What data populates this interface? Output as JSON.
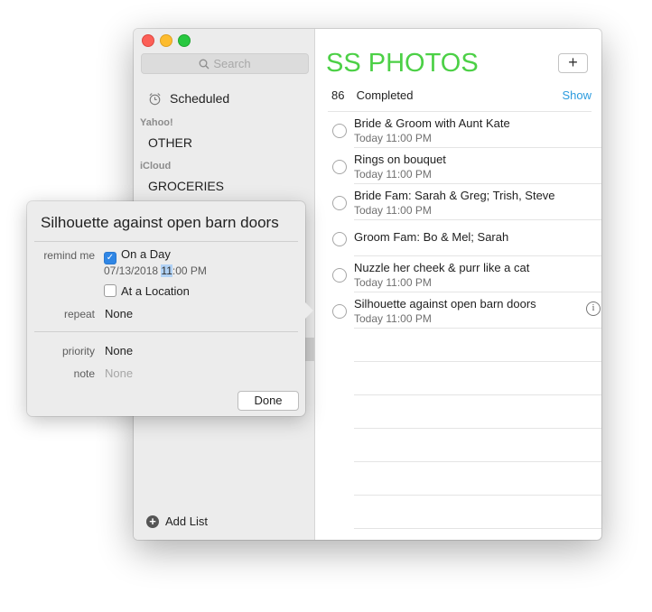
{
  "sidebar": {
    "search_placeholder": "Search",
    "scheduled_label": "Scheduled",
    "accounts": [
      {
        "name": "Yahoo!",
        "lists": [
          "OTHER"
        ]
      },
      {
        "name": "iCloud",
        "lists": [
          "GROCERIES"
        ]
      }
    ],
    "add_list_label": "Add List"
  },
  "main": {
    "list_title": "SS PHOTOS",
    "add_button_label": "+",
    "completed_count": "86",
    "completed_label": "Completed",
    "show_label": "Show",
    "tasks": [
      {
        "title": "Bride & Groom with Aunt Kate",
        "due": "Today 11:00 PM"
      },
      {
        "title": "Rings on bouquet",
        "due": "Today 11:00 PM"
      },
      {
        "title": "Bride Fam: Sarah & Greg; Trish, Steve",
        "due": "Today 11:00 PM"
      },
      {
        "title": "Groom Fam: Bo & Mel; Sarah",
        "due": ""
      },
      {
        "title": "Nuzzle her cheek & purr like a cat",
        "due": "Today 11:00 PM"
      },
      {
        "title": "Silhouette against open barn doors",
        "due": "Today 11:00 PM"
      }
    ]
  },
  "popover": {
    "title": "Silhouette against open barn doors",
    "remind_me_label": "remind me",
    "on_a_day_label": "On a Day",
    "date_prefix": "07/13/2018 ",
    "date_hour": "11",
    "date_suffix": ":00 PM",
    "at_location_label": "At a Location",
    "repeat_label": "repeat",
    "repeat_value": "None",
    "priority_label": "priority",
    "priority_value": "None",
    "note_label": "note",
    "note_placeholder": "None",
    "done_label": "Done"
  },
  "colors": {
    "list_title": "#4cd046",
    "show_link": "#2b9bde",
    "checkbox_checked": "#2f86e5"
  }
}
